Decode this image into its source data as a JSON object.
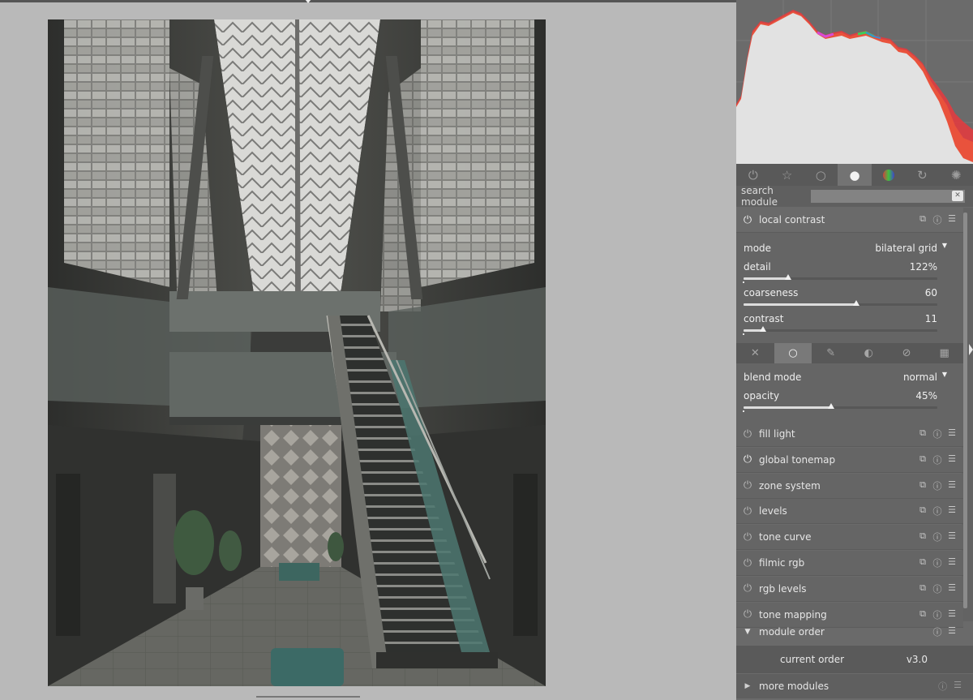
{
  "search": {
    "label": "search module",
    "placeholder": ""
  },
  "module_groups": [
    {
      "icon": "power-icon",
      "active": false
    },
    {
      "icon": "star-icon",
      "active": false
    },
    {
      "icon": "circle-icon",
      "active": false
    },
    {
      "icon": "tone-circle-icon",
      "active": true
    },
    {
      "icon": "color-circle-icon",
      "active": false
    },
    {
      "icon": "correct-icon",
      "active": false
    },
    {
      "icon": "effect-icon",
      "active": false
    }
  ],
  "local_contrast": {
    "name": "local contrast",
    "mode_label": "mode",
    "mode_value": "bilateral grid",
    "detail": {
      "label": "detail",
      "value": "122%",
      "level": 0.23
    },
    "coarseness": {
      "label": "coarseness",
      "value": "60",
      "level": 0.58
    },
    "contrast": {
      "label": "contrast",
      "value": "11",
      "level": 0.1
    },
    "blend_mode_label": "blend mode",
    "blend_mode_value": "normal",
    "opacity": {
      "label": "opacity",
      "value": "45%",
      "level": 0.45
    }
  },
  "blend_tabs": [
    {
      "icon": "blend-off-icon",
      "active": false
    },
    {
      "icon": "blend-uniform-icon",
      "active": true
    },
    {
      "icon": "drawn-mask-icon",
      "active": false
    },
    {
      "icon": "parametric-mask-icon",
      "active": false
    },
    {
      "icon": "drawn-parametric-mask-icon",
      "active": false
    },
    {
      "icon": "raster-mask-icon",
      "active": false
    }
  ],
  "modules": [
    {
      "name": "fill light",
      "on": false
    },
    {
      "name": "global tonemap",
      "on": true
    },
    {
      "name": "zone system",
      "on": false
    },
    {
      "name": "levels",
      "on": false
    },
    {
      "name": "tone curve",
      "on": false
    },
    {
      "name": "filmic rgb",
      "on": false
    },
    {
      "name": "rgb levels",
      "on": false
    },
    {
      "name": "tone mapping",
      "on": false
    }
  ],
  "module_order": {
    "name": "module order",
    "current_label": "current order",
    "current_value": "v3.0"
  },
  "more_modules": {
    "name": "more modules"
  },
  "colors": {
    "panel_bg": "#6a6a6a",
    "center_bg": "#b9b9b9",
    "hist_fill": "#e2e2e2",
    "hist_red": "#e8383d",
    "hist_yellow": "#f0e03a",
    "hist_magenta": "#d84ad8",
    "hist_green": "#3ad05a"
  }
}
